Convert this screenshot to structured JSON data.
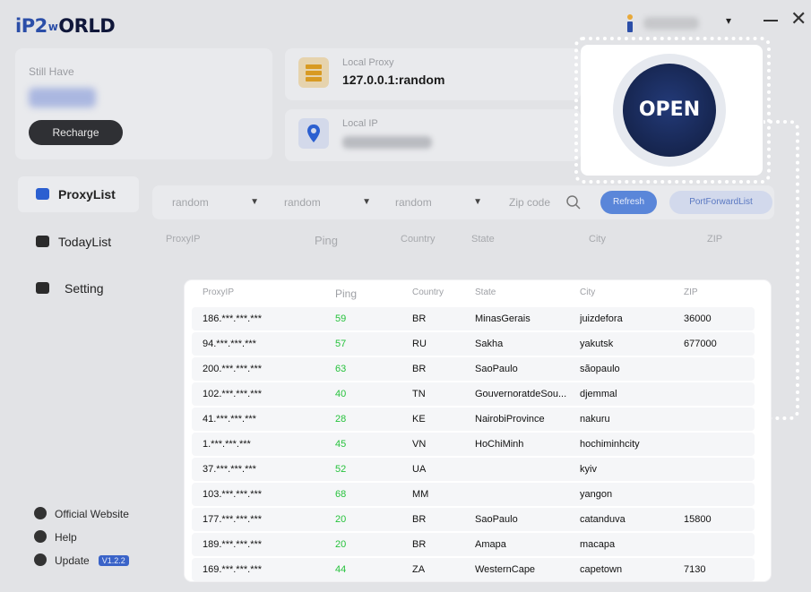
{
  "app": {
    "logo": {
      "part1": "iP2",
      "part2": "w",
      "part3": "ORLD"
    },
    "user_menu_caret": "▾",
    "window": {
      "minimize": "—",
      "close": "✕"
    }
  },
  "balance": {
    "label": "Still Have",
    "recharge_label": "Recharge"
  },
  "local_proxy": {
    "label": "Local Proxy",
    "value": "127.0.0.1:random"
  },
  "local_ip": {
    "label": "Local IP"
  },
  "open_button": {
    "label": "OPEN"
  },
  "sidebar": {
    "items": [
      {
        "label": "ProxyList",
        "icon": "proxylist-icon",
        "active": true
      },
      {
        "label": "TodayList",
        "icon": "todaylist-icon",
        "active": false
      },
      {
        "label": "Setting",
        "icon": "setting-icon",
        "active": false
      }
    ]
  },
  "filters": {
    "country": "random",
    "state": "random",
    "city": "random",
    "zip_placeholder": "Zip code",
    "refresh_label": "Refresh",
    "portforward_label": "PortForwardList"
  },
  "columns": [
    "ProxyIP",
    "Ping",
    "Country",
    "State",
    "City",
    "ZIP"
  ],
  "rows": [
    {
      "ip": "186.***.***.***",
      "ping": "59",
      "country": "BR",
      "state": "MinasGerais",
      "city": "juizdefora",
      "zip": "36000"
    },
    {
      "ip": "94.***.***.***",
      "ping": "57",
      "country": "RU",
      "state": "Sakha",
      "city": "yakutsk",
      "zip": "677000"
    },
    {
      "ip": "200.***.***.***",
      "ping": "63",
      "country": "BR",
      "state": "SaoPaulo",
      "city": "sãopaulo",
      "zip": ""
    },
    {
      "ip": "102.***.***.***",
      "ping": "40",
      "country": "TN",
      "state": "GouvernoratdeSou...",
      "city": "djemmal",
      "zip": ""
    },
    {
      "ip": "41.***.***.***",
      "ping": "28",
      "country": "KE",
      "state": "NairobiProvince",
      "city": "nakuru",
      "zip": ""
    },
    {
      "ip": "1.***.***.***",
      "ping": "45",
      "country": "VN",
      "state": "HoChiMinh",
      "city": "hochiminhcity",
      "zip": ""
    },
    {
      "ip": "37.***.***.***",
      "ping": "52",
      "country": "UA",
      "state": "",
      "city": "kyiv",
      "zip": ""
    },
    {
      "ip": "103.***.***.***",
      "ping": "68",
      "country": "MM",
      "state": "",
      "city": "yangon",
      "zip": ""
    },
    {
      "ip": "177.***.***.***",
      "ping": "20",
      "country": "BR",
      "state": "SaoPaulo",
      "city": "catanduva",
      "zip": "15800"
    },
    {
      "ip": "189.***.***.***",
      "ping": "20",
      "country": "BR",
      "state": "Amapa",
      "city": "macapa",
      "zip": ""
    },
    {
      "ip": "169.***.***.***",
      "ping": "44",
      "country": "ZA",
      "state": "WesternCape",
      "city": "capetown",
      "zip": "7130"
    }
  ],
  "footer": {
    "official_website": "Official Website",
    "help": "Help",
    "update": "Update",
    "version": "V1.2.2"
  },
  "colors": {
    "accent": "#3a63c8",
    "ping_good": "#26c23c",
    "open_button": "#16254f"
  }
}
